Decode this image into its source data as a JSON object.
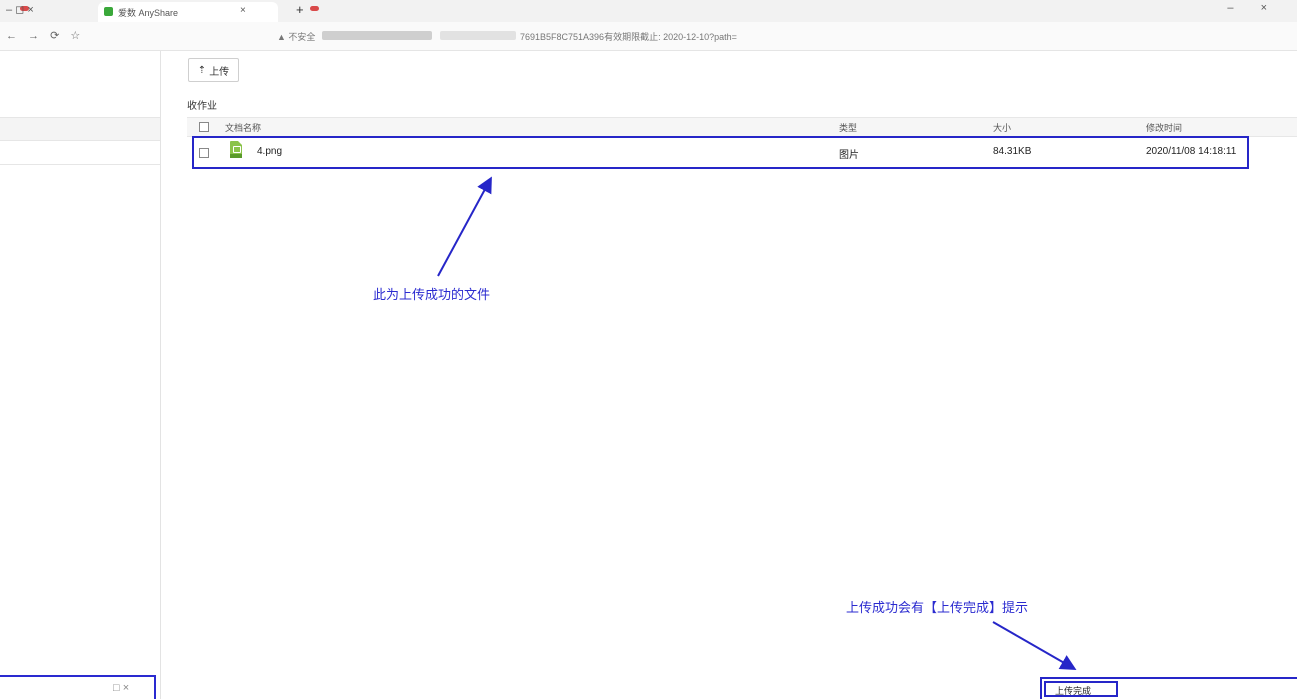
{
  "browser": {
    "tab_title": "爱数 AnyShare",
    "tab_close": "×",
    "new_tab": "+",
    "window_controls": "– ×",
    "left_controls": "– ◻ ×",
    "nav_icons": "← → ⟳ ☆",
    "insecure_label": "▲ 不安全",
    "url_fragment": "7691B5F8C751A396有效期限截止: 2020-12-10?path="
  },
  "toolbar": {
    "upload_icon": "⇡",
    "upload_label": "上传"
  },
  "folder": {
    "title": "收作业"
  },
  "table": {
    "headers": {
      "name": "文档名称",
      "type": "类型",
      "size": "大小",
      "modified": "修改时间"
    },
    "rows": [
      {
        "name": "4.png",
        "type": "图片",
        "size": "84.31KB",
        "modified": "2020/11/08 14:18:11",
        "icon": "image-file-icon"
      }
    ]
  },
  "annotations": {
    "uploaded_file_note": "此为上传成功的文件",
    "toast_note": "上传成功会有【上传完成】提示"
  },
  "toast": {
    "label": "上传完成"
  },
  "bottom_dialog": {
    "controls": "□ ×"
  },
  "colors": {
    "annotation_blue": "#2626c8",
    "file_icon_green": "#8bc34a"
  }
}
